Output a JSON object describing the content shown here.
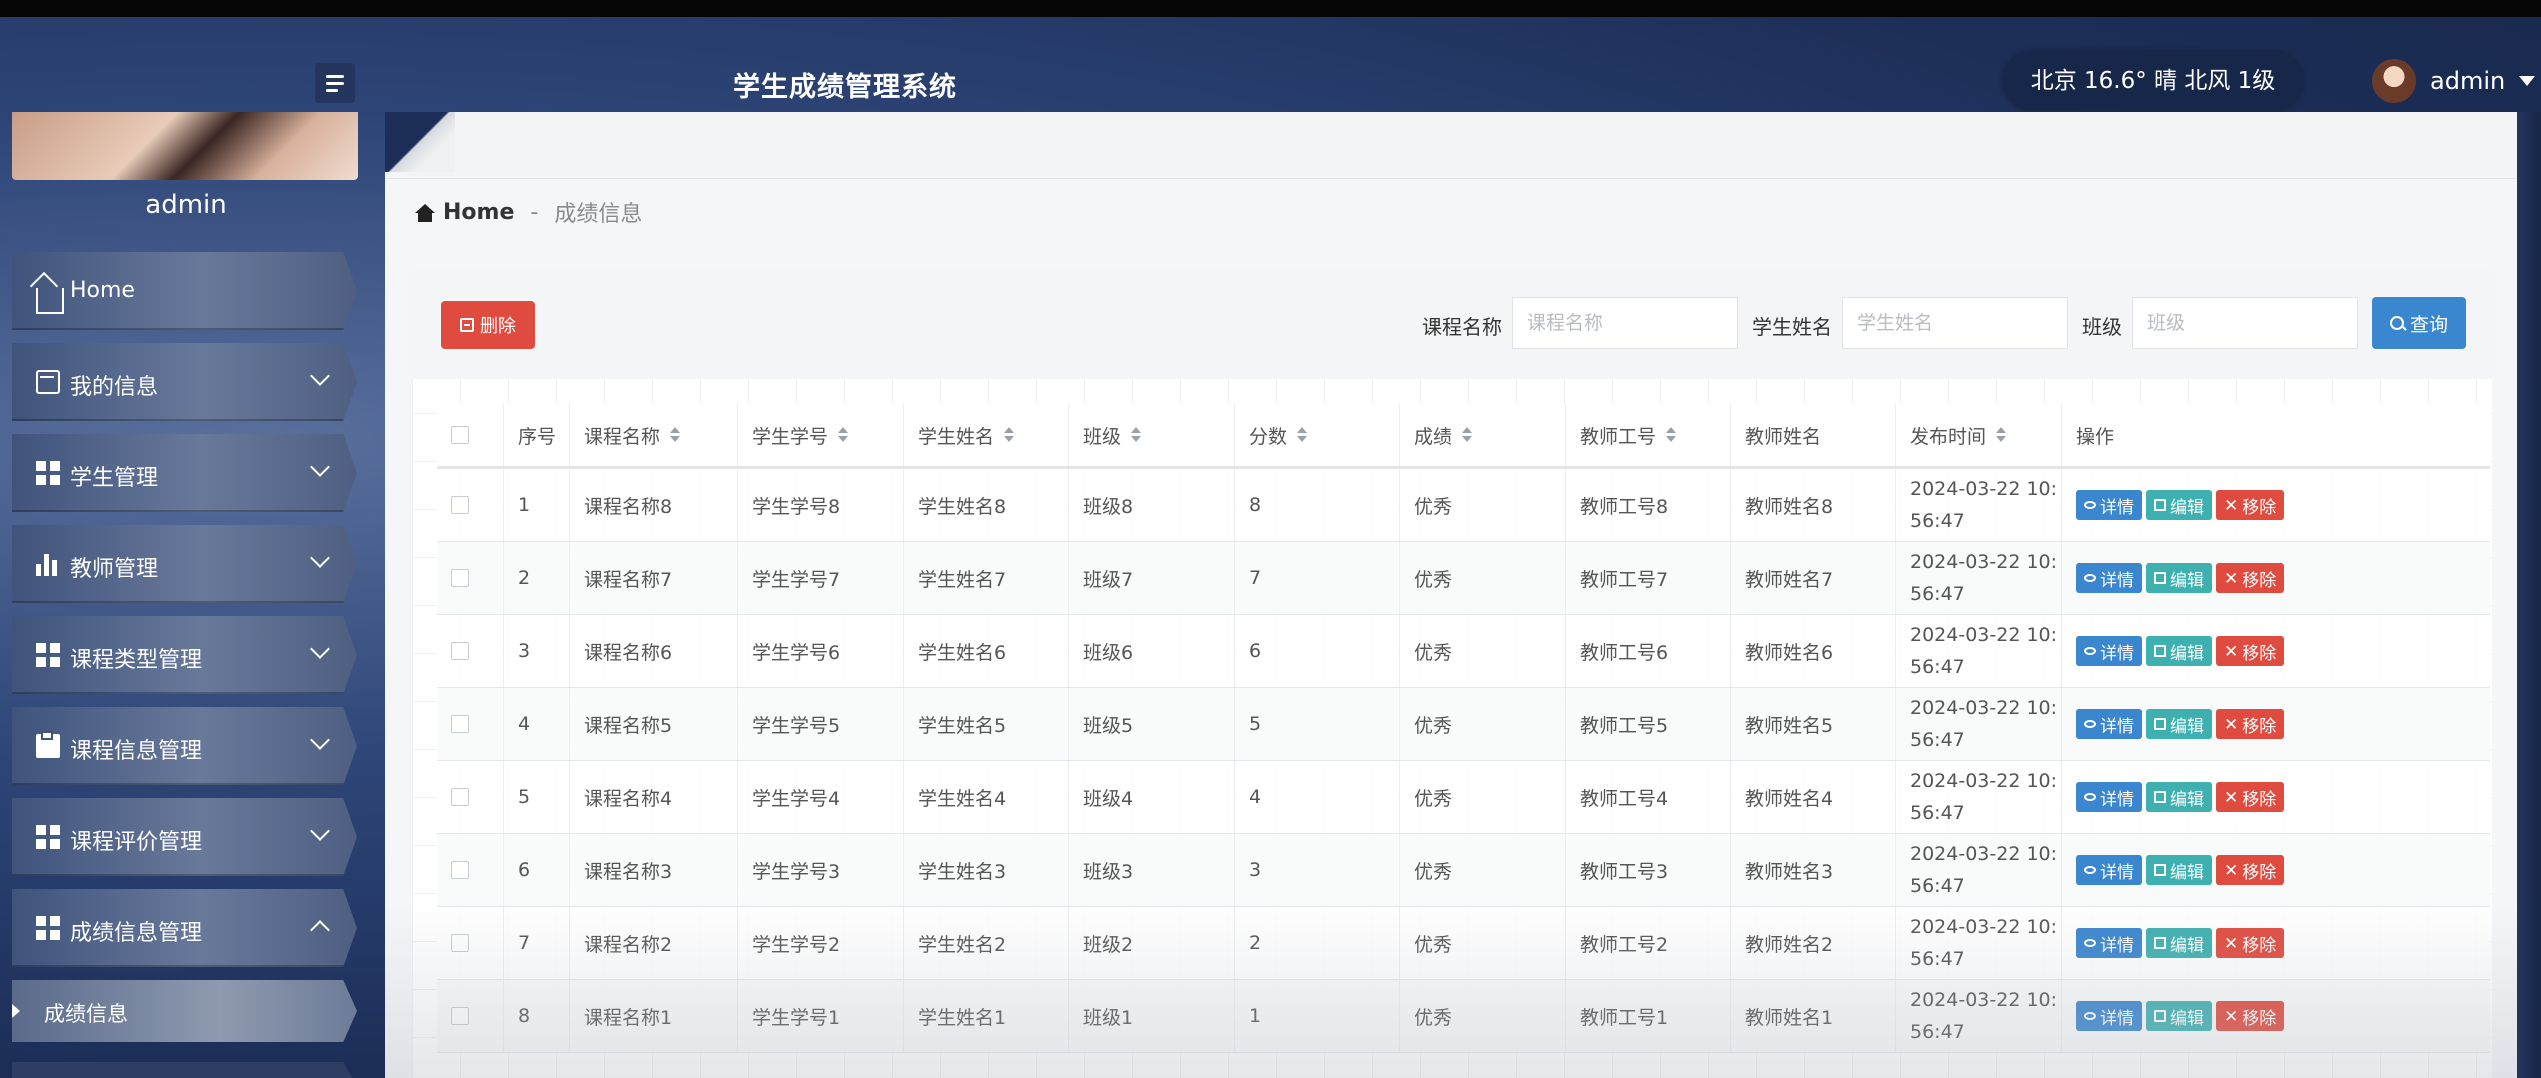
{
  "header": {
    "title": "学生成绩管理系统",
    "weather": "北京  16.6°  晴  北风  1级",
    "username": "admin"
  },
  "sidebar": {
    "profile_name": "admin",
    "items": [
      {
        "label": "Home",
        "icon": "home-icon",
        "expandable": false
      },
      {
        "label": "我的信息",
        "icon": "card-icon",
        "expandable": true
      },
      {
        "label": "学生管理",
        "icon": "grid-icon",
        "expandable": true
      },
      {
        "label": "教师管理",
        "icon": "bar-chart-icon",
        "expandable": true
      },
      {
        "label": "课程类型管理",
        "icon": "grid-icon",
        "expandable": true
      },
      {
        "label": "课程信息管理",
        "icon": "clipboard-icon",
        "expandable": true
      },
      {
        "label": "课程评价管理",
        "icon": "grid-icon",
        "expandable": true
      },
      {
        "label": "成绩信息管理",
        "icon": "grid-icon",
        "expandable": true,
        "expanded": true
      }
    ],
    "sub_item": "成绩信息"
  },
  "breadcrumb": {
    "home": "Home",
    "separator": "-",
    "current": "成绩信息"
  },
  "toolbar": {
    "delete_label": "删除",
    "filters": [
      {
        "label": "课程名称",
        "placeholder": "课程名称",
        "value": ""
      },
      {
        "label": "学生姓名",
        "placeholder": "学生姓名",
        "value": ""
      },
      {
        "label": "班级",
        "placeholder": "班级",
        "value": ""
      }
    ],
    "search_label": "查询"
  },
  "table": {
    "columns": [
      "序号",
      "课程名称",
      "学生学号",
      "学生姓名",
      "班级",
      "分数",
      "成绩",
      "教师工号",
      "教师姓名",
      "发布时间",
      "操作"
    ],
    "sortable": [
      false,
      true,
      true,
      true,
      true,
      true,
      true,
      true,
      false,
      true,
      false
    ],
    "actions": {
      "detail": "详情",
      "edit": "编辑",
      "remove": "移除"
    },
    "rows": [
      {
        "index": "1",
        "course": "课程名称8",
        "student_no": "学生学号8",
        "student_name": "学生姓名8",
        "class": "班级8",
        "score": "8",
        "grade": "优秀",
        "teacher_no": "教师工号8",
        "teacher_name": "教师姓名8",
        "time_line1": "2024-03-22 10:",
        "time_line2": "56:47"
      },
      {
        "index": "2",
        "course": "课程名称7",
        "student_no": "学生学号7",
        "student_name": "学生姓名7",
        "class": "班级7",
        "score": "7",
        "grade": "优秀",
        "teacher_no": "教师工号7",
        "teacher_name": "教师姓名7",
        "time_line1": "2024-03-22 10:",
        "time_line2": "56:47"
      },
      {
        "index": "3",
        "course": "课程名称6",
        "student_no": "学生学号6",
        "student_name": "学生姓名6",
        "class": "班级6",
        "score": "6",
        "grade": "优秀",
        "teacher_no": "教师工号6",
        "teacher_name": "教师姓名6",
        "time_line1": "2024-03-22 10:",
        "time_line2": "56:47"
      },
      {
        "index": "4",
        "course": "课程名称5",
        "student_no": "学生学号5",
        "student_name": "学生姓名5",
        "class": "班级5",
        "score": "5",
        "grade": "优秀",
        "teacher_no": "教师工号5",
        "teacher_name": "教师姓名5",
        "time_line1": "2024-03-22 10:",
        "time_line2": "56:47"
      },
      {
        "index": "5",
        "course": "课程名称4",
        "student_no": "学生学号4",
        "student_name": "学生姓名4",
        "class": "班级4",
        "score": "4",
        "grade": "优秀",
        "teacher_no": "教师工号4",
        "teacher_name": "教师姓名4",
        "time_line1": "2024-03-22 10:",
        "time_line2": "56:47"
      },
      {
        "index": "6",
        "course": "课程名称3",
        "student_no": "学生学号3",
        "student_name": "学生姓名3",
        "class": "班级3",
        "score": "3",
        "grade": "优秀",
        "teacher_no": "教师工号3",
        "teacher_name": "教师姓名3",
        "time_line1": "2024-03-22 10:",
        "time_line2": "56:47"
      },
      {
        "index": "7",
        "course": "课程名称2",
        "student_no": "学生学号2",
        "student_name": "学生姓名2",
        "class": "班级2",
        "score": "2",
        "grade": "优秀",
        "teacher_no": "教师工号2",
        "teacher_name": "教师姓名2",
        "time_line1": "2024-03-22 10:",
        "time_line2": "56:47"
      },
      {
        "index": "8",
        "course": "课程名称1",
        "student_no": "学生学号1",
        "student_name": "学生姓名1",
        "class": "班级1",
        "score": "1",
        "grade": "优秀",
        "teacher_no": "教师工号1",
        "teacher_name": "教师姓名1",
        "time_line1": "2024-03-22 10:",
        "time_line2": "56:47"
      }
    ]
  },
  "colors": {
    "danger": "#e04b3f",
    "primary": "#3a86cf",
    "info": "#3fb0b0",
    "header_bg": "#1c2e57"
  }
}
